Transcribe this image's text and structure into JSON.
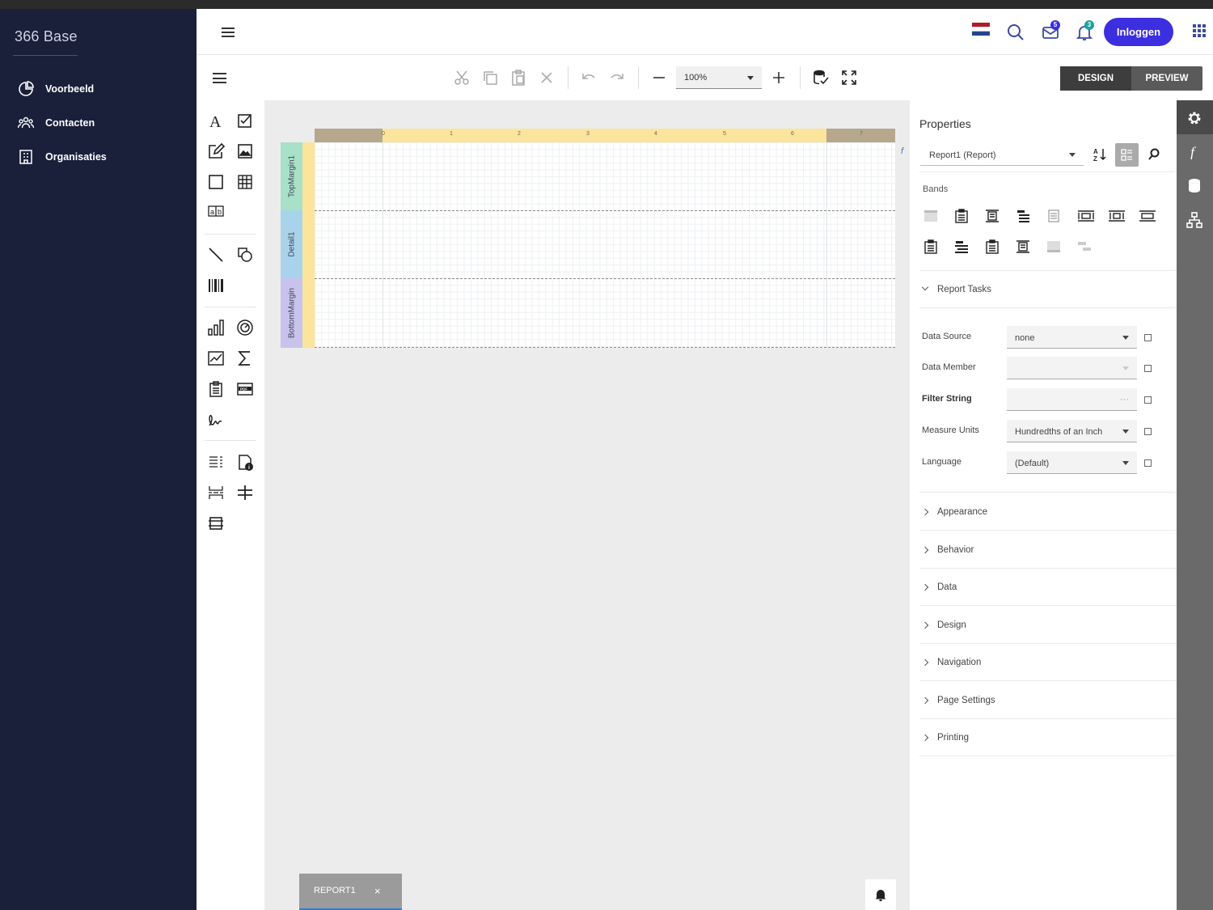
{
  "app": {
    "brand": "366 Base"
  },
  "sidebar": {
    "items": [
      {
        "label": "Voorbeeld",
        "icon": "pie-chart-icon"
      },
      {
        "label": "Contacten",
        "icon": "people-icon"
      },
      {
        "label": "Organisaties",
        "icon": "building-icon"
      }
    ]
  },
  "header": {
    "login_label": "Inloggen",
    "mail_badge": "5",
    "notif_badge": "3",
    "flag": "flag-nl-icon"
  },
  "toolbar": {
    "zoom_value": "100%",
    "design_label": "DESIGN",
    "preview_label": "PREVIEW"
  },
  "designer": {
    "ruler_ticks": [
      "0",
      "1",
      "2",
      "3",
      "4",
      "5",
      "6",
      "7"
    ],
    "bands": [
      "TopMargin1",
      "Detail1",
      "BottomMargin"
    ],
    "doc_tab": "REPORT1",
    "doc_tab_close": "×"
  },
  "properties": {
    "title": "Properties",
    "selected_object": "Report1 (Report)",
    "bands_label": "Bands",
    "tasks_label": "Report Tasks",
    "rows": [
      {
        "label": "Data Source",
        "value": "none"
      },
      {
        "label": "Data Member",
        "value": ""
      },
      {
        "label": "Filter String",
        "value": "···"
      },
      {
        "label": "Measure Units",
        "value": "Hundredths of an Inch"
      },
      {
        "label": "Language",
        "value": "(Default)"
      }
    ],
    "sections": [
      "Appearance",
      "Behavior",
      "Data",
      "Design",
      "Navigation",
      "Page Settings",
      "Printing"
    ]
  },
  "colors": {
    "sidebar_bg": "#1a1f3a",
    "accent": "#3b2fe0",
    "ruler": "#fbe49b",
    "band_top": "#a8e0c8",
    "band_detail": "#a9d3ea",
    "band_bottom": "#c7c3ec"
  }
}
